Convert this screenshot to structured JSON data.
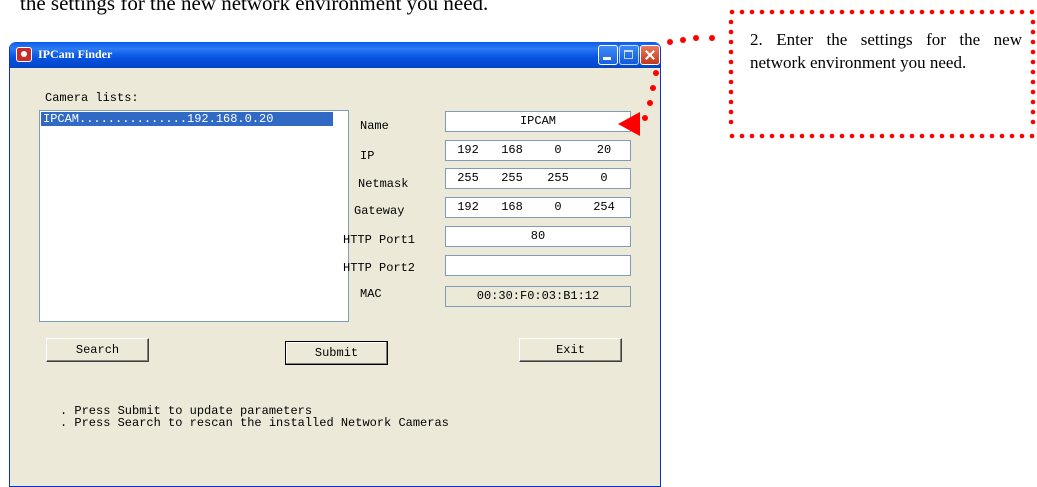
{
  "page": {
    "cut_heading": "the settings for the new network environment you need."
  },
  "window": {
    "title": "IPCam Finder",
    "title_icon": "camera-app-icon",
    "buttons": {
      "minimize": "minimize-icon",
      "maximize": "maximize-icon",
      "close": "close-icon"
    }
  },
  "camera_list": {
    "label": "Camera lists:",
    "items": [
      {
        "name": "IPCAM",
        "ip": "192.168.0.20",
        "display": "IPCAM...............192.168.0.20 "
      }
    ]
  },
  "form": {
    "name": {
      "label": "Name",
      "value": "IPCAM"
    },
    "ip": {
      "label": "IP",
      "octets": [
        "192",
        "168",
        "0",
        "20"
      ]
    },
    "netmask": {
      "label": "Netmask",
      "octets": [
        "255",
        "255",
        "255",
        "0"
      ]
    },
    "gateway": {
      "label": "Gateway",
      "octets": [
        "192",
        "168",
        "0",
        "254"
      ]
    },
    "http_port1": {
      "label": "HTTP Port1",
      "value": "80"
    },
    "http_port2": {
      "label": "HTTP Port2",
      "value": ""
    },
    "mac": {
      "label": "MAC",
      "value": "00:30:F0:03:B1:12"
    }
  },
  "buttons": {
    "search": "Search",
    "submit": "Submit",
    "exit": "Exit"
  },
  "hints": [
    ". Press Submit to update parameters",
    ". Press Search to rescan the installed Network Cameras"
  ],
  "callout": {
    "text": "2. Enter the settings for the new network environment you need.",
    "dot_color": "#FF0000"
  }
}
